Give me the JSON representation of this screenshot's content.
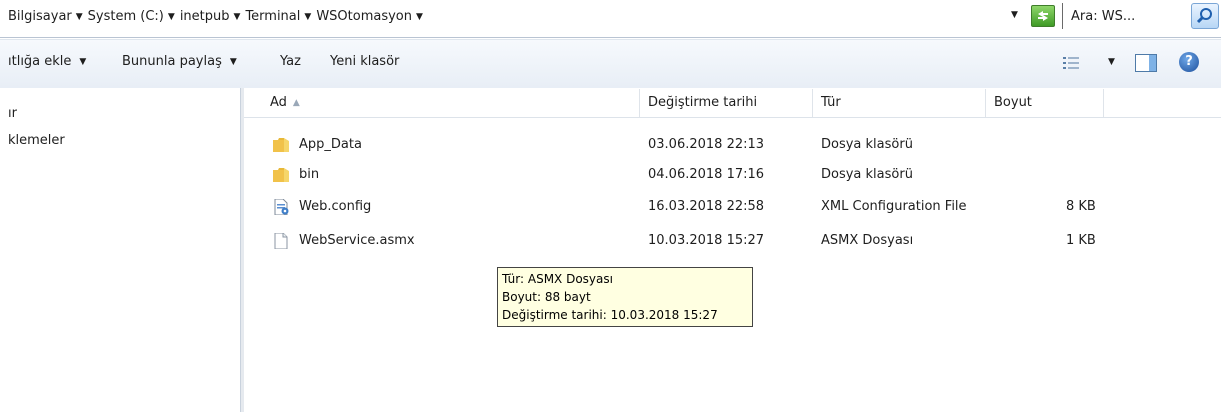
{
  "address_bar": {
    "breadcrumbs": [
      "Bilgisayar",
      "System (C:)",
      "inetpub",
      "Terminal",
      "WSOtomasyon"
    ],
    "search_label": "Ara: WS..."
  },
  "toolbar": {
    "include_library": "ıtlığa ekle",
    "share_with": "Bununla paylaş",
    "burn": "Yaz",
    "new_folder": "Yeni klasör"
  },
  "nav_pane": {
    "items": [
      "ır",
      "klemeler"
    ]
  },
  "columns": {
    "name": "Ad",
    "date_modified": "Değiştirme tarihi",
    "type": "Tür",
    "size": "Boyut"
  },
  "files": [
    {
      "name": "App_Data",
      "date": "03.06.2018 22:13",
      "type": "Dosya klasörü",
      "size": "",
      "icon": "folder-icon"
    },
    {
      "name": "bin",
      "date": "04.06.2018 17:16",
      "type": "Dosya klasörü",
      "size": "",
      "icon": "folder-icon"
    },
    {
      "name": "Web.config",
      "date": "16.03.2018 22:58",
      "type": "XML Configuration File",
      "size": "8 KB",
      "icon": "config-file-icon"
    },
    {
      "name": "WebService.asmx",
      "date": "10.03.2018 15:27",
      "type": "ASMX Dosyası",
      "size": "1 KB",
      "icon": "blank-file-icon"
    }
  ],
  "tooltip": {
    "line1": "Tür: ASMX Dosyası",
    "line2": "Boyut: 88 bayt",
    "line3": "Değiştirme tarihi: 10.03.2018 15:27"
  },
  "colors": {
    "tooltip_bg": "#ffffe1",
    "toolbar_bg": "#eef3f9"
  }
}
